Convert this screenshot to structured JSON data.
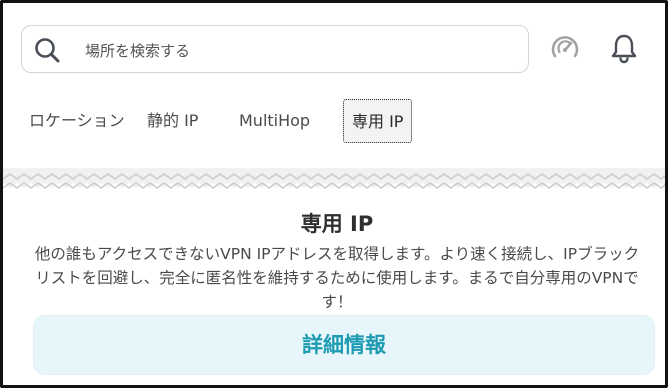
{
  "search": {
    "placeholder": "場所を検索する",
    "icon": "search-icon"
  },
  "header_icons": [
    "speed-test-icon",
    "bell-icon"
  ],
  "tabs": [
    {
      "label": "ロケーション",
      "selected": false
    },
    {
      "label": "静的 IP",
      "selected": false
    },
    {
      "label": "MultiHop",
      "selected": false
    },
    {
      "label": "専用 IP",
      "selected": true
    }
  ],
  "panel": {
    "title": "専用 IP",
    "description": "他の誰もアクセスできないVPN IPアドレスを取得します。より速く接続し、IPブラックリストを回避し、完全に匿名性を維持するために使用します。まるで自分専用のVPNです！",
    "button_label": "詳細情報"
  },
  "colors": {
    "accent": "#1e9bb2",
    "button_bg": "#e6f6fa",
    "zigzag_fill": "#f0f1f2",
    "zigzag_stroke": "#c8cacc",
    "icon_gray": "#9a9a9a",
    "icon_dark": "#4a4f57"
  }
}
